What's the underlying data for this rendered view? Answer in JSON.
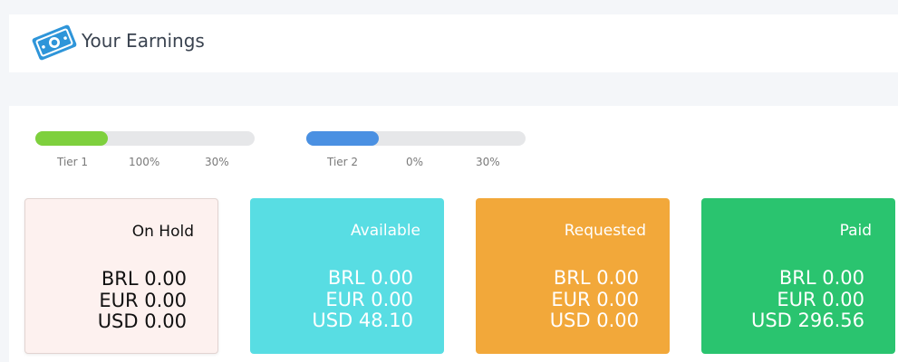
{
  "header": {
    "title": "Your Earnings",
    "icon": "money-bill-icon"
  },
  "tiers": [
    {
      "name": "Tier 1",
      "progress": "100%",
      "rate": "30%",
      "bar_fill_fraction": 0.33,
      "bar_color": "#7ed03d"
    },
    {
      "name": "Tier 2",
      "progress": "0%",
      "rate": "30%",
      "bar_fill_fraction": 0.33,
      "bar_color": "#4a90e2"
    }
  ],
  "cards": [
    {
      "title": "On Hold",
      "bg": "#fdf1ef",
      "text_color": "#111111",
      "amounts": [
        "BRL 0.00",
        "EUR 0.00",
        "USD 0.00"
      ]
    },
    {
      "title": "Available",
      "bg": "#58dde3",
      "text_color": "#ffffff",
      "amounts": [
        "BRL 0.00",
        "EUR 0.00",
        "USD 48.10"
      ]
    },
    {
      "title": "Requested",
      "bg": "#f2a83a",
      "text_color": "#ffffff",
      "amounts": [
        "BRL 0.00",
        "EUR 0.00",
        "USD 0.00"
      ]
    },
    {
      "title": "Paid",
      "bg": "#2ac46f",
      "text_color": "#ffffff",
      "amounts": [
        "BRL 0.00",
        "EUR 0.00",
        "USD 296.56"
      ]
    }
  ]
}
